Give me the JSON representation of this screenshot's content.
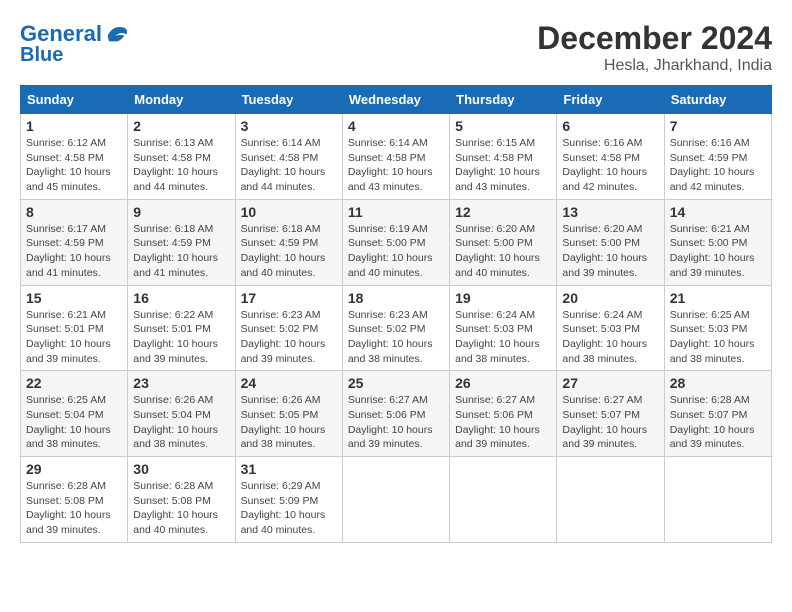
{
  "header": {
    "logo_line1": "General",
    "logo_line2": "Blue",
    "main_title": "December 2024",
    "subtitle": "Hesla, Jharkhand, India"
  },
  "weekdays": [
    "Sunday",
    "Monday",
    "Tuesday",
    "Wednesday",
    "Thursday",
    "Friday",
    "Saturday"
  ],
  "weeks": [
    [
      {
        "day": "1",
        "sunrise": "6:12 AM",
        "sunset": "4:58 PM",
        "daylight": "10 hours and 45 minutes."
      },
      {
        "day": "2",
        "sunrise": "6:13 AM",
        "sunset": "4:58 PM",
        "daylight": "10 hours and 44 minutes."
      },
      {
        "day": "3",
        "sunrise": "6:14 AM",
        "sunset": "4:58 PM",
        "daylight": "10 hours and 44 minutes."
      },
      {
        "day": "4",
        "sunrise": "6:14 AM",
        "sunset": "4:58 PM",
        "daylight": "10 hours and 43 minutes."
      },
      {
        "day": "5",
        "sunrise": "6:15 AM",
        "sunset": "4:58 PM",
        "daylight": "10 hours and 43 minutes."
      },
      {
        "day": "6",
        "sunrise": "6:16 AM",
        "sunset": "4:58 PM",
        "daylight": "10 hours and 42 minutes."
      },
      {
        "day": "7",
        "sunrise": "6:16 AM",
        "sunset": "4:59 PM",
        "daylight": "10 hours and 42 minutes."
      }
    ],
    [
      {
        "day": "8",
        "sunrise": "6:17 AM",
        "sunset": "4:59 PM",
        "daylight": "10 hours and 41 minutes."
      },
      {
        "day": "9",
        "sunrise": "6:18 AM",
        "sunset": "4:59 PM",
        "daylight": "10 hours and 41 minutes."
      },
      {
        "day": "10",
        "sunrise": "6:18 AM",
        "sunset": "4:59 PM",
        "daylight": "10 hours and 40 minutes."
      },
      {
        "day": "11",
        "sunrise": "6:19 AM",
        "sunset": "5:00 PM",
        "daylight": "10 hours and 40 minutes."
      },
      {
        "day": "12",
        "sunrise": "6:20 AM",
        "sunset": "5:00 PM",
        "daylight": "10 hours and 40 minutes."
      },
      {
        "day": "13",
        "sunrise": "6:20 AM",
        "sunset": "5:00 PM",
        "daylight": "10 hours and 39 minutes."
      },
      {
        "day": "14",
        "sunrise": "6:21 AM",
        "sunset": "5:00 PM",
        "daylight": "10 hours and 39 minutes."
      }
    ],
    [
      {
        "day": "15",
        "sunrise": "6:21 AM",
        "sunset": "5:01 PM",
        "daylight": "10 hours and 39 minutes."
      },
      {
        "day": "16",
        "sunrise": "6:22 AM",
        "sunset": "5:01 PM",
        "daylight": "10 hours and 39 minutes."
      },
      {
        "day": "17",
        "sunrise": "6:23 AM",
        "sunset": "5:02 PM",
        "daylight": "10 hours and 39 minutes."
      },
      {
        "day": "18",
        "sunrise": "6:23 AM",
        "sunset": "5:02 PM",
        "daylight": "10 hours and 38 minutes."
      },
      {
        "day": "19",
        "sunrise": "6:24 AM",
        "sunset": "5:03 PM",
        "daylight": "10 hours and 38 minutes."
      },
      {
        "day": "20",
        "sunrise": "6:24 AM",
        "sunset": "5:03 PM",
        "daylight": "10 hours and 38 minutes."
      },
      {
        "day": "21",
        "sunrise": "6:25 AM",
        "sunset": "5:03 PM",
        "daylight": "10 hours and 38 minutes."
      }
    ],
    [
      {
        "day": "22",
        "sunrise": "6:25 AM",
        "sunset": "5:04 PM",
        "daylight": "10 hours and 38 minutes."
      },
      {
        "day": "23",
        "sunrise": "6:26 AM",
        "sunset": "5:04 PM",
        "daylight": "10 hours and 38 minutes."
      },
      {
        "day": "24",
        "sunrise": "6:26 AM",
        "sunset": "5:05 PM",
        "daylight": "10 hours and 38 minutes."
      },
      {
        "day": "25",
        "sunrise": "6:27 AM",
        "sunset": "5:06 PM",
        "daylight": "10 hours and 39 minutes."
      },
      {
        "day": "26",
        "sunrise": "6:27 AM",
        "sunset": "5:06 PM",
        "daylight": "10 hours and 39 minutes."
      },
      {
        "day": "27",
        "sunrise": "6:27 AM",
        "sunset": "5:07 PM",
        "daylight": "10 hours and 39 minutes."
      },
      {
        "day": "28",
        "sunrise": "6:28 AM",
        "sunset": "5:07 PM",
        "daylight": "10 hours and 39 minutes."
      }
    ],
    [
      {
        "day": "29",
        "sunrise": "6:28 AM",
        "sunset": "5:08 PM",
        "daylight": "10 hours and 39 minutes."
      },
      {
        "day": "30",
        "sunrise": "6:28 AM",
        "sunset": "5:08 PM",
        "daylight": "10 hours and 40 minutes."
      },
      {
        "day": "31",
        "sunrise": "6:29 AM",
        "sunset": "5:09 PM",
        "daylight": "10 hours and 40 minutes."
      },
      null,
      null,
      null,
      null
    ]
  ]
}
